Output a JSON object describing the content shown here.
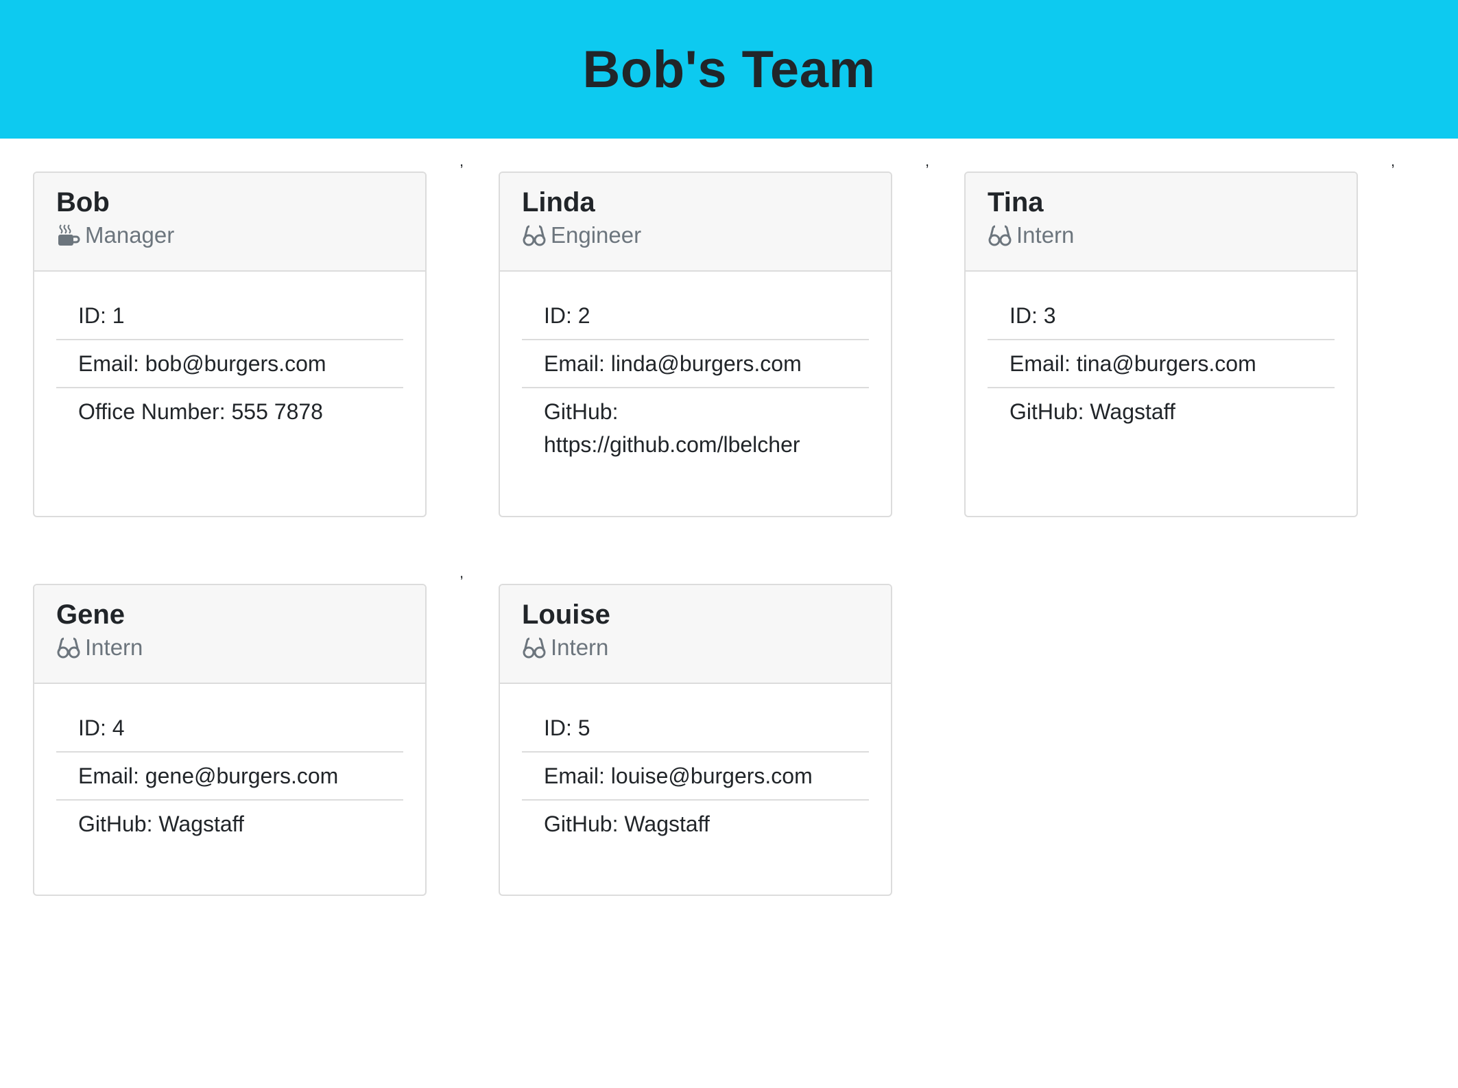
{
  "header": {
    "title": "Bob's Team"
  },
  "cards": [
    {
      "name": "Bob",
      "role": "Manager",
      "role_icon": "mug-icon",
      "rows": [
        "ID: 1",
        "Email: bob@burgers.com",
        "Office Number: 555 7878"
      ]
    },
    {
      "name": "Linda",
      "role": "Engineer",
      "role_icon": "glasses-icon",
      "rows": [
        "ID: 2",
        "Email: linda@burgers.com",
        "GitHub: https://github.com/lbelcher"
      ]
    },
    {
      "name": "Tina",
      "role": "Intern",
      "role_icon": "glasses-icon",
      "rows": [
        "ID: 3",
        "Email: tina@burgers.com",
        "GitHub: Wagstaff"
      ]
    },
    {
      "name": "Gene",
      "role": "Intern",
      "role_icon": "glasses-icon",
      "rows": [
        "ID: 4",
        "Email: gene@burgers.com",
        "GitHub: Wagstaff"
      ]
    },
    {
      "name": "Louise",
      "role": "Intern",
      "role_icon": "glasses-icon",
      "rows": [
        "ID: 5",
        "Email: louise@burgers.com",
        "GitHub: Wagstaff"
      ]
    }
  ],
  "separators": {
    "comma": ","
  }
}
